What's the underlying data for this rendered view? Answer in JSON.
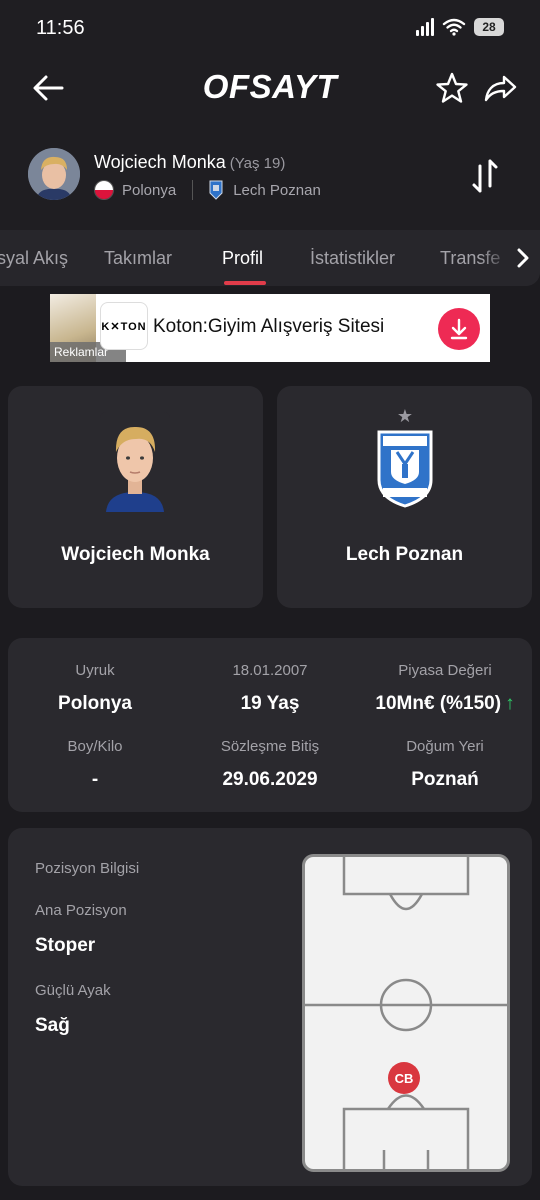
{
  "status_bar": {
    "time": "11:56",
    "battery": "28"
  },
  "header": {
    "logo": "OFSAYT"
  },
  "player": {
    "name": "Wojciech Monka",
    "age": "(Yaş 19)",
    "country": "Polonya",
    "club": "Lech Poznan"
  },
  "tabs": {
    "items": [
      {
        "label": "syal Akış"
      },
      {
        "label": "Takımlar"
      },
      {
        "label": "Profil"
      },
      {
        "label": "İstatistikler"
      },
      {
        "label": "Transfe"
      }
    ],
    "active": "Profil"
  },
  "ad": {
    "image_label": "Reklamlar",
    "logo_text": "K✕TON",
    "title": "Koton:Giyim Alışveriş Sitesi"
  },
  "cards": {
    "player_name": "Wojciech Monka",
    "club_name": "Lech Poznan"
  },
  "info": {
    "cells": [
      {
        "label": "Uyruk",
        "value": "Polonya"
      },
      {
        "label": "18.01.2007",
        "value": "19 Yaş"
      },
      {
        "label": "Piyasa Değeri",
        "value": "10Mn€ (%150)",
        "trend": "up"
      },
      {
        "label": "Boy/Kilo",
        "value": "-"
      },
      {
        "label": "Sözleşme Bitiş",
        "value": "29.06.2029"
      },
      {
        "label": "Doğum Yeri",
        "value": "Poznań"
      }
    ]
  },
  "position": {
    "section_title": "Pozisyon Bilgisi",
    "main_label": "Ana Pozisyon",
    "main_value": "Stoper",
    "foot_label": "Güçlü Ayak",
    "foot_value": "Sağ",
    "marker": "CB"
  },
  "colors": {
    "accent": "#e03c4a",
    "background": "#1c1b1f",
    "card": "#2a292e",
    "trend_up": "#2fcf6a",
    "ad_button": "#ee2a54"
  },
  "icons": [
    "back-arrow-icon",
    "star-icon",
    "share-icon",
    "swap-icon",
    "chevron-right-icon",
    "download-icon"
  ]
}
